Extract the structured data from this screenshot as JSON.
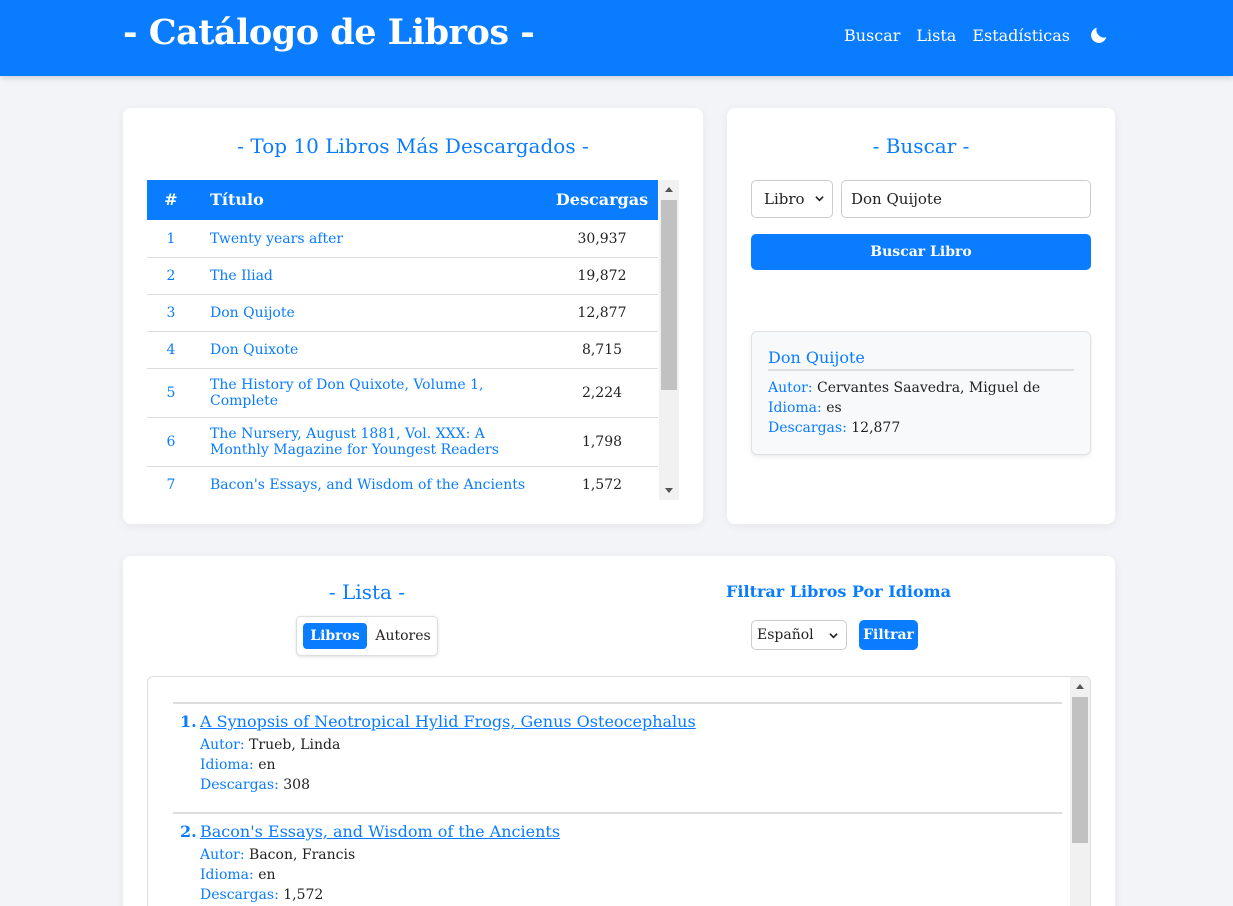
{
  "header": {
    "brand": "- Catálogo de Libros -",
    "nav": [
      "Buscar",
      "Lista",
      "Estadísticas"
    ],
    "theme_icon": "moon-icon"
  },
  "top10": {
    "title": "- Top 10 Libros Más Descargados -",
    "columns": [
      "#",
      "Título",
      "Descargas"
    ],
    "rows": [
      {
        "num": "1",
        "title": "Twenty years after",
        "downloads": "30,937"
      },
      {
        "num": "2",
        "title": "The Iliad",
        "downloads": "19,872"
      },
      {
        "num": "3",
        "title": "Don Quijote",
        "downloads": "12,877"
      },
      {
        "num": "4",
        "title": "Don Quixote",
        "downloads": "8,715"
      },
      {
        "num": "5",
        "title": "The History of Don Quixote, Volume 1, Complete",
        "downloads": "2,224"
      },
      {
        "num": "6",
        "title": "The Nursery, August 1881, Vol. XXX: A Monthly Magazine for Youngest Readers",
        "downloads": "1,798"
      },
      {
        "num": "7",
        "title": "Bacon's Essays, and Wisdom of the Ancients",
        "downloads": "1,572"
      }
    ]
  },
  "buscar": {
    "title": "- Buscar -",
    "type_value": "Libro",
    "query_value": "Don Quijote",
    "button_label": "Buscar Libro",
    "result": {
      "title": "Don Quijote",
      "autor_label": "Autor:",
      "autor": "Cervantes Saavedra, Miguel de",
      "idioma_label": "Idioma:",
      "idioma": "es",
      "descargas_label": "Descargas:",
      "descargas": "12,877"
    }
  },
  "lista": {
    "title": "- Lista -",
    "toggle": {
      "active": "Libros",
      "other": "Autores"
    },
    "filter_title": "Filtrar Libros Por Idioma",
    "language_value": "Español",
    "filter_button": "Filtrar",
    "items": [
      {
        "num": "1.",
        "title": "A Synopsis of Neotropical Hylid Frogs, Genus Osteocephalus",
        "autor_label": "Autor:",
        "autor": "Trueb, Linda",
        "idioma_label": "Idioma:",
        "idioma": "en",
        "descargas_label": "Descargas:",
        "descargas": "308"
      },
      {
        "num": "2.",
        "title": "Bacon's Essays, and Wisdom of the Ancients",
        "autor_label": "Autor:",
        "autor": "Bacon, Francis",
        "idioma_label": "Idioma:",
        "idioma": "en",
        "descargas_label": "Descargas:",
        "descargas": "1,572"
      }
    ]
  }
}
